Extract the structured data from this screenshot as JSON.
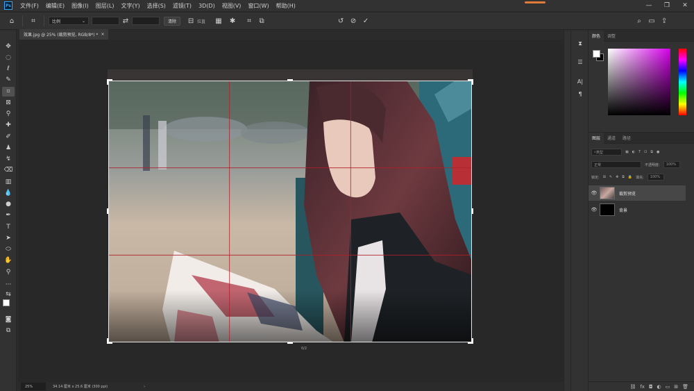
{
  "menubar": {
    "logo": "Ps",
    "items": [
      "文件(F)",
      "编辑(E)",
      "图像(I)",
      "图层(L)",
      "文字(Y)",
      "选择(S)",
      "滤镜(T)",
      "3D(D)",
      "视图(V)",
      "窗口(W)",
      "帮助(H)"
    ],
    "controls": [
      "—",
      "❐",
      "✕"
    ]
  },
  "options": {
    "ratio_label": "比例",
    "clear_label": "清除",
    "straighten_label": "拉直"
  },
  "document": {
    "tab_title": "效果.jpg @ 25% (裁剪预览, RGB/8*) *",
    "tab_close": "×",
    "crop_info": "0/2"
  },
  "status": {
    "zoom": "25%",
    "doc_info": "34.14 厘米 x 25.6 厘米 (300 ppi)",
    "arrow": "›"
  },
  "color_panel": {
    "tabs": [
      "颜色",
      "调整"
    ],
    "fg": "#ffffff",
    "bg": "#000000"
  },
  "layers_panel": {
    "tabs": [
      "图层",
      "通道",
      "路径"
    ],
    "filter_label": "类型",
    "blend_mode": "正常",
    "opacity_label": "不透明度:",
    "opacity_value": "100%",
    "lock_label": "锁定:",
    "fill_label": "填充:",
    "fill_value": "100%",
    "layers": [
      {
        "name": "裁剪预览",
        "selected": true
      },
      {
        "name": "背景",
        "selected": false
      }
    ],
    "footer_icons": [
      "⛓",
      "fx",
      "◘",
      "◐",
      "▭",
      "⊞",
      "🗑"
    ]
  },
  "colors": {
    "crop_guide": "#b01f2a",
    "accent": "#31a8ff"
  }
}
